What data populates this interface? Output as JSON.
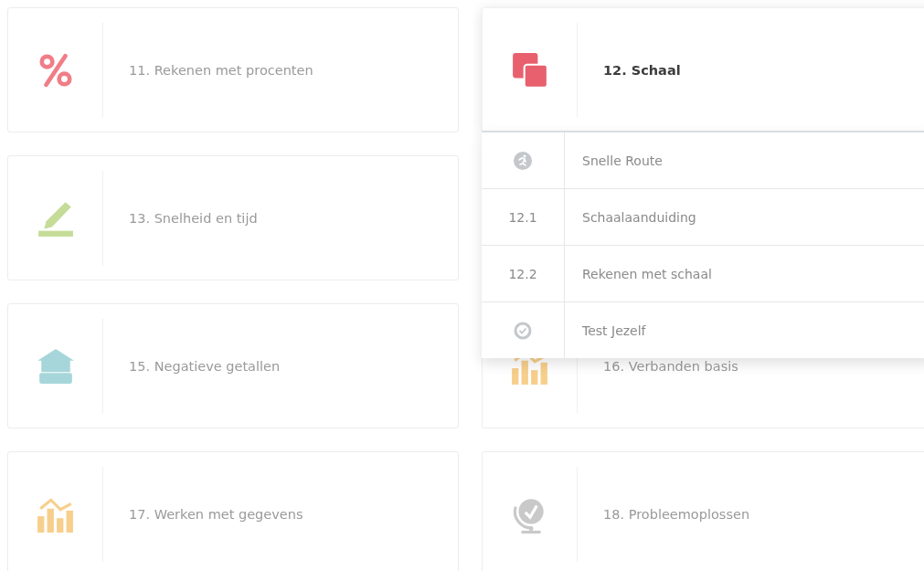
{
  "cards": [
    {
      "title": "11. Rekenen met procenten",
      "kind": "percent",
      "color": "#f07d87",
      "expanded": false
    },
    {
      "title": "12. Schaal",
      "kind": "squares",
      "color": "#e8606e",
      "expanded": true,
      "menu": [
        {
          "kind": "runner",
          "label": "Snelle Route"
        },
        {
          "kind": "number",
          "number": "12.1",
          "label": "Schaalaanduiding"
        },
        {
          "kind": "number",
          "number": "12.2",
          "label": "Rekenen met schaal"
        },
        {
          "kind": "check",
          "label": "Test Jezelf"
        }
      ]
    },
    {
      "title": "13. Snelheid en tijd",
      "kind": "pencil",
      "color": "#c5dc98",
      "expanded": false
    },
    {
      "title": "15. Negatieve getallen",
      "kind": "house",
      "color": "#a6d6da",
      "expanded": false
    },
    {
      "title": "16. Verbanden basis",
      "kind": "chart",
      "color": "#f7cf8c",
      "expanded": false
    },
    {
      "title": "17. Werken met gegevens",
      "kind": "chart",
      "color": "#f7cf8c",
      "expanded": false
    },
    {
      "title": "18. Probleemoplossen",
      "kind": "globe",
      "color": "#c9c9c9",
      "expanded": false
    }
  ]
}
